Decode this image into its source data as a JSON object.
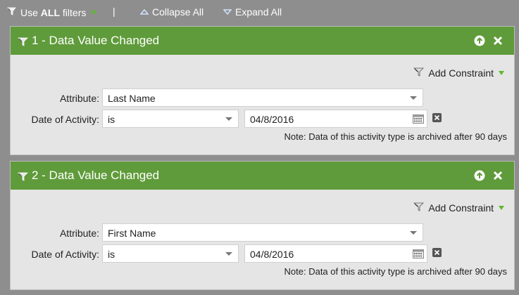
{
  "toolbar": {
    "use_all_prefix": "Use ",
    "use_all_bold": "ALL",
    "use_all_suffix": " filters",
    "separator": "|",
    "collapse_all": "Collapse All",
    "expand_all": "Expand All"
  },
  "filters": [
    {
      "title": "1 - Data Value Changed",
      "add_constraint": "Add Constraint",
      "attribute_label": "Attribute:",
      "attribute_value": "Last Name",
      "date_label": "Date of Activity:",
      "date_operator": "is",
      "date_value": "04/8/2016",
      "note": "Note: Data of this activity type is archived after 90 days"
    },
    {
      "title": "2 - Data Value Changed",
      "add_constraint": "Add Constraint",
      "attribute_label": "Attribute:",
      "attribute_value": "First Name",
      "date_label": "Date of Activity:",
      "date_operator": "is",
      "date_value": "04/8/2016",
      "note": "Note: Data of this activity type is archived after 90 days"
    }
  ],
  "colors": {
    "header_green": "#5f9b3a",
    "accent_green": "#5cb82e",
    "page_bg": "#8e8e8e",
    "card_bg": "#e5e5e5"
  },
  "icons": {
    "filter": "funnel-icon",
    "move_up": "arrow-up-circle-icon",
    "remove": "close-x-icon",
    "calendar": "calendar-icon",
    "clear": "clear-box-icon"
  }
}
